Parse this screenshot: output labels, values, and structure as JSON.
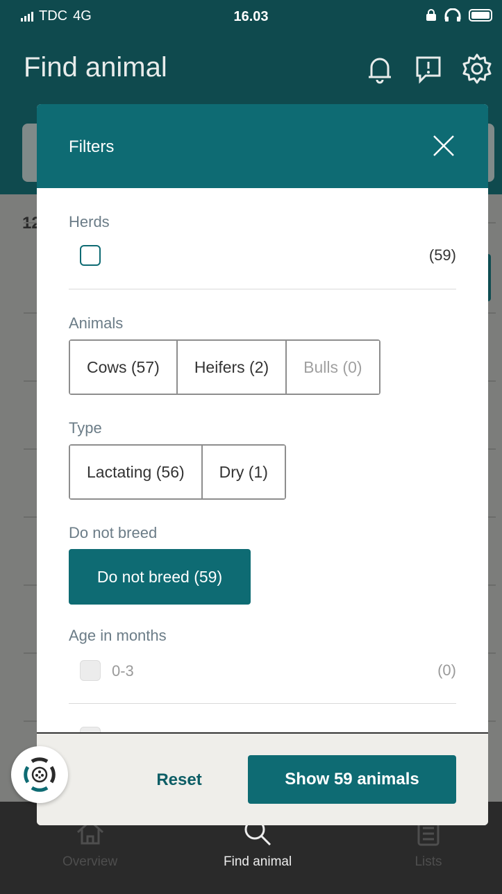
{
  "status_bar": {
    "carrier": "TDC",
    "network": "4G",
    "time": "16.03"
  },
  "app": {
    "title": "Find animal",
    "partial_count": "12"
  },
  "icons": {
    "notifications": "bell-icon",
    "feedback": "exclamation-square-icon",
    "settings": "gear-icon",
    "close": "close-icon",
    "app_logo": "cycle-logo-icon"
  },
  "nav": {
    "items": [
      {
        "label": "Overview",
        "icon": "home-icon"
      },
      {
        "label": "Find animal",
        "icon": "search-icon"
      },
      {
        "label": "Lists",
        "icon": "list-icon"
      }
    ]
  },
  "filters": {
    "title": "Filters",
    "herds": {
      "label": "Herds",
      "count": "(59)"
    },
    "animals": {
      "label": "Animals",
      "options": [
        "Cows (57)",
        "Heifers (2)",
        "Bulls (0)"
      ]
    },
    "type": {
      "label": "Type",
      "options": [
        "Lactating (56)",
        "Dry (1)"
      ]
    },
    "do_not_breed": {
      "label": "Do not breed",
      "button": "Do not breed (59)"
    },
    "age": {
      "label": "Age in months",
      "items": [
        {
          "range": "0-3",
          "count": "(0)"
        }
      ]
    },
    "reset_label": "Reset",
    "show_label": "Show 59 animals"
  },
  "colors": {
    "primary": "#0e6b73",
    "app_bar": "#0f4a4e",
    "label_gray": "#6b7c87",
    "footer_bg": "#efeeea"
  }
}
